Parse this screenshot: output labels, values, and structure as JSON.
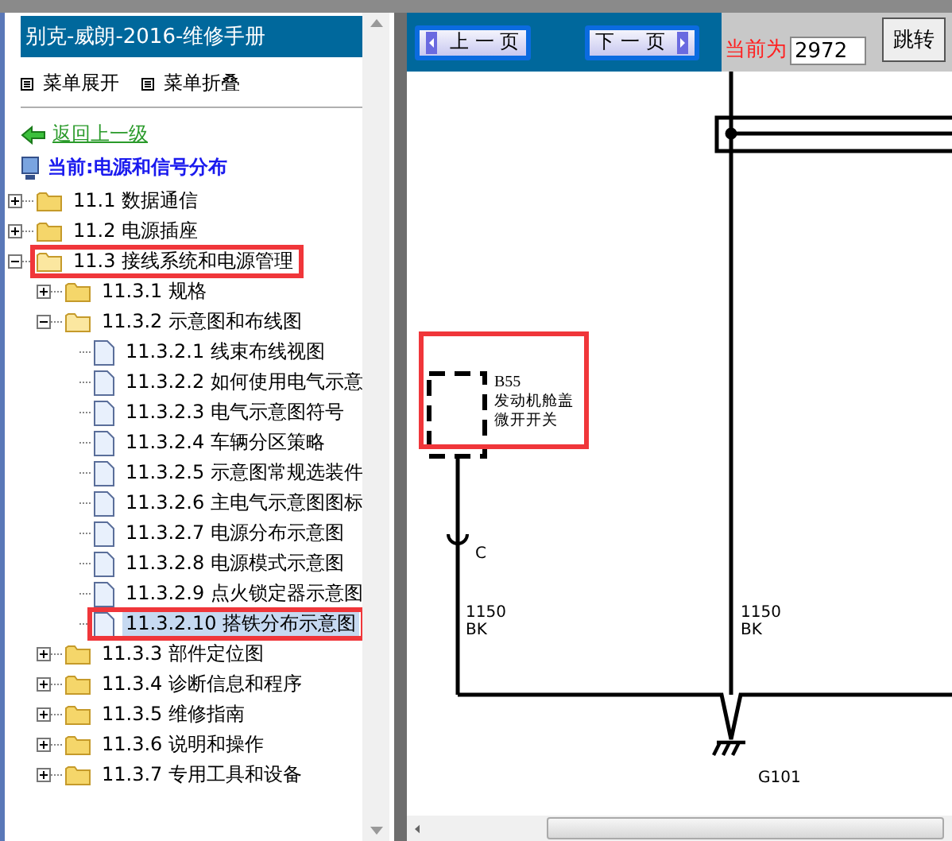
{
  "title": "别克-威朗-2016-维修手册",
  "menu_actions": [
    {
      "label": "菜单展开"
    },
    {
      "label": "菜单折叠"
    }
  ],
  "back_link": "返回上一级",
  "current": "当前:电源和信号分布",
  "tree": [
    {
      "label": "11.1 数据通信",
      "kind": "folder",
      "expanded": false,
      "selected": false,
      "highlighted": false
    },
    {
      "label": "11.2 电源插座",
      "kind": "folder",
      "expanded": false,
      "selected": false,
      "highlighted": false
    },
    {
      "label": "11.3 接线系统和电源管理",
      "kind": "folder",
      "expanded": true,
      "selected": false,
      "highlighted": true,
      "children": [
        {
          "label": "11.3.1 规格",
          "kind": "folder",
          "expanded": false,
          "selected": false,
          "highlighted": false
        },
        {
          "label": "11.3.2 示意图和布线图",
          "kind": "folder",
          "expanded": true,
          "selected": false,
          "highlighted": false,
          "children": [
            {
              "label": "11.3.2.1 线束布线视图",
              "kind": "doc",
              "selected": false,
              "highlighted": false
            },
            {
              "label": "11.3.2.2 如何使用电气示意",
              "kind": "doc",
              "selected": false,
              "highlighted": false
            },
            {
              "label": "11.3.2.3 电气示意图符号",
              "kind": "doc",
              "selected": false,
              "highlighted": false
            },
            {
              "label": "11.3.2.4 车辆分区策略",
              "kind": "doc",
              "selected": false,
              "highlighted": false
            },
            {
              "label": "11.3.2.5 示意图常规选装件",
              "kind": "doc",
              "selected": false,
              "highlighted": false
            },
            {
              "label": "11.3.2.6 主电气示意图图标",
              "kind": "doc",
              "selected": false,
              "highlighted": false
            },
            {
              "label": "11.3.2.7 电源分布示意图",
              "kind": "doc",
              "selected": false,
              "highlighted": false
            },
            {
              "label": "11.3.2.8 电源模式示意图",
              "kind": "doc",
              "selected": false,
              "highlighted": false
            },
            {
              "label": "11.3.2.9 点火锁定器示意图",
              "kind": "doc",
              "selected": false,
              "highlighted": false
            },
            {
              "label": "11.3.2.10 搭铁分布示意图",
              "kind": "doc",
              "selected": true,
              "highlighted": true
            }
          ]
        },
        {
          "label": "11.3.3 部件定位图",
          "kind": "folder",
          "expanded": false,
          "selected": false,
          "highlighted": false
        },
        {
          "label": "11.3.4 诊断信息和程序",
          "kind": "folder",
          "expanded": false,
          "selected": false,
          "highlighted": false
        },
        {
          "label": "11.3.5 维修指南",
          "kind": "folder",
          "expanded": false,
          "selected": false,
          "highlighted": false
        },
        {
          "label": "11.3.6 说明和操作",
          "kind": "folder",
          "expanded": false,
          "selected": false,
          "highlighted": false
        },
        {
          "label": "11.3.7 专用工具和设备",
          "kind": "folder",
          "expanded": false,
          "selected": false,
          "highlighted": false
        }
      ]
    }
  ],
  "toolbar": {
    "prev": "上 一 页",
    "next": "下 一 页",
    "page_label": "当前为",
    "page_value": "2972",
    "go": "跳转"
  },
  "diagram": {
    "component": {
      "code": "B55",
      "name_lines": [
        "发动机舱盖",
        "微开开关"
      ],
      "highlighted": true
    },
    "connector": "C",
    "wires": [
      {
        "circuit": "1150",
        "color_code": "BK"
      },
      {
        "circuit": "1150",
        "color_code": "BK"
      }
    ],
    "ground": "G101"
  }
}
